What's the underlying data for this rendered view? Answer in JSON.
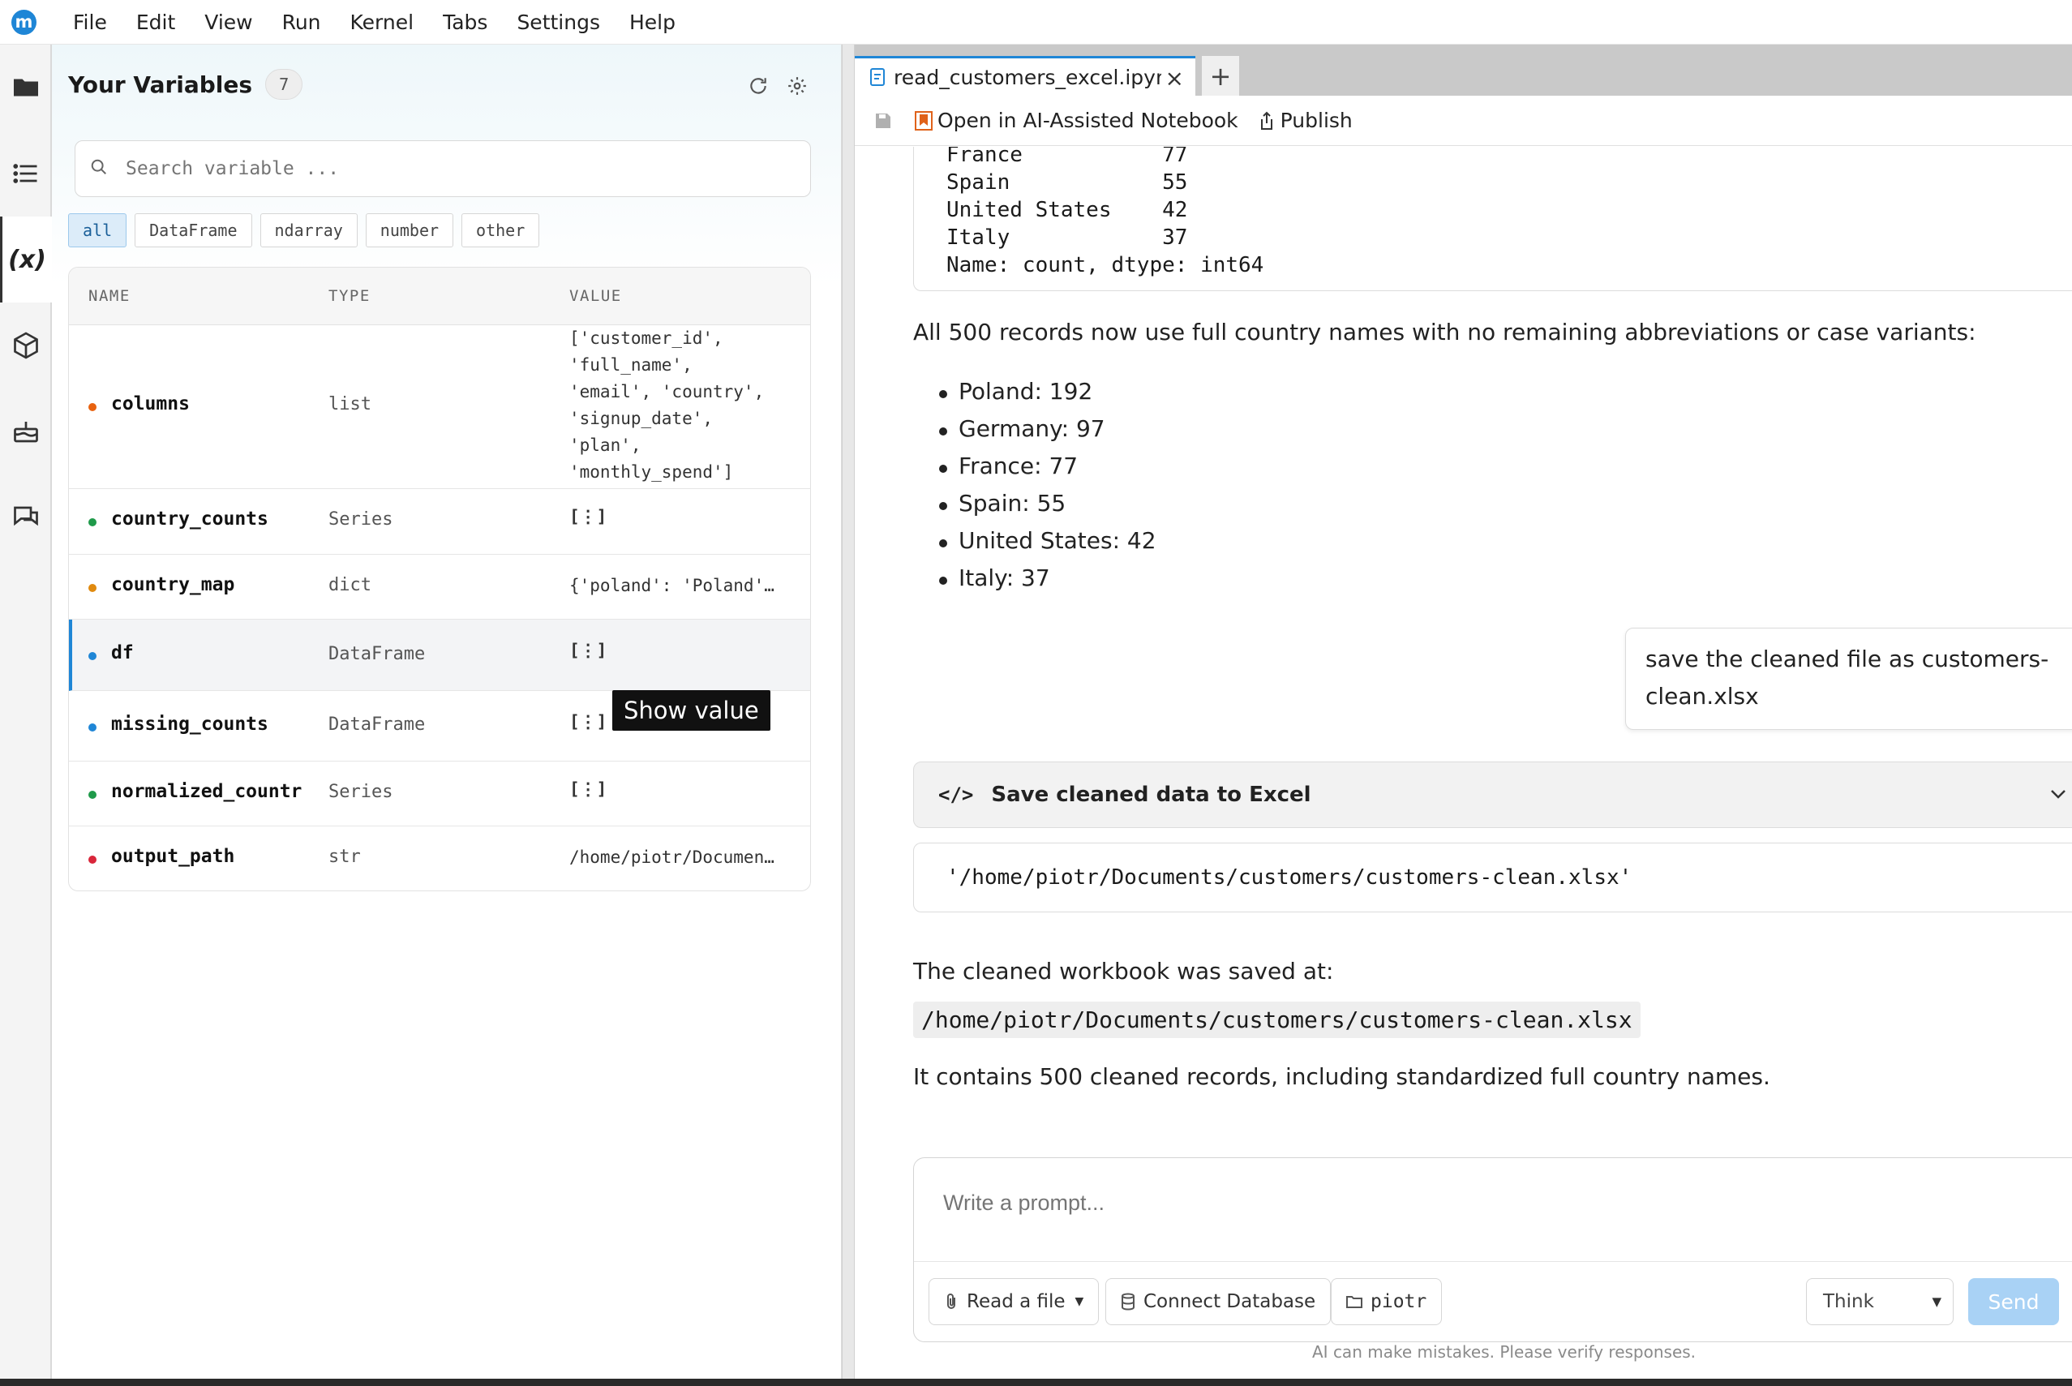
{
  "menubar": {
    "items": [
      "File",
      "Edit",
      "View",
      "Run",
      "Kernel",
      "Tabs",
      "Settings",
      "Help"
    ]
  },
  "activity_icons": [
    "folder-icon",
    "list-icon",
    "variables-icon",
    "package-icon",
    "cake-icon",
    "chat-icon"
  ],
  "variables_panel": {
    "title": "Your Variables",
    "count": "7",
    "search_placeholder": "Search variable ...",
    "filters": [
      "all",
      "DataFrame",
      "ndarray",
      "number",
      "other"
    ],
    "active_filter": "all",
    "headers": {
      "name": "NAME",
      "type": "TYPE",
      "value": "VALUE"
    },
    "rows": [
      {
        "name": "columns",
        "type": "list",
        "value": "['customer_id',\n'full_name',\n'email', 'country',\n'signup_date',\n'plan',\n'monthly_spend']",
        "dot_color": "#e8620f"
      },
      {
        "name": "country_counts",
        "type": "Series",
        "value": "",
        "dot_color": "#1f9a4a"
      },
      {
        "name": "country_map",
        "type": "dict",
        "value": "{'poland': 'Poland'…",
        "dot_color": "#e08a0f"
      },
      {
        "name": "df",
        "type": "DataFrame",
        "value": "",
        "dot_color": "#1f86d6"
      },
      {
        "name": "missing_counts",
        "type": "DataFrame",
        "value": "",
        "dot_color": "#1f86d6"
      },
      {
        "name": "normalized_countr",
        "type": "Series",
        "value": "",
        "dot_color": "#1f9a4a"
      },
      {
        "name": "output_path",
        "type": "str",
        "value": "/home/piotr/Documen…",
        "dot_color": "#d9263a"
      }
    ],
    "tooltip": "Show value"
  },
  "tabs": {
    "file_tab": "read_customers_excel.ipynb"
  },
  "toolbar": {
    "open_ai": "Open in AI-Assisted Notebook",
    "publish": "Publish"
  },
  "notebook": {
    "output_lines": [
      "France           77",
      "Spain            55",
      "United States    42",
      "Italy            37",
      "Name: count, dtype: int64"
    ],
    "summary_text": "All 500 records now use full country names with no remaining abbreviations or case variants:",
    "country_list": [
      "Poland: 192",
      "Germany: 97",
      "France: 77",
      "Spain: 55",
      "United States: 42",
      "Italy: 37"
    ],
    "user_message": "save the cleaned file as customers-clean.xlsx",
    "code_cell_title": "Save cleaned data to Excel",
    "code_output": "'/home/piotr/Documents/customers/customers-clean.xlsx'",
    "saved_text": "The cleaned workbook was saved at:",
    "saved_path": "/home/piotr/Documents/customers/customers-clean.xlsx",
    "contains_text": "It contains 500 cleaned records, including standardized full country names."
  },
  "prompt": {
    "placeholder": "Write a prompt...",
    "read_file": "Read a file",
    "connect_db": "Connect Database",
    "folder": "piotr",
    "think": "Think",
    "send": "Send",
    "disclaimer": "AI can make mistakes. Please verify responses."
  },
  "colors": {
    "accent": "#1f86d6",
    "send_disabled": "#a9d2f5"
  }
}
